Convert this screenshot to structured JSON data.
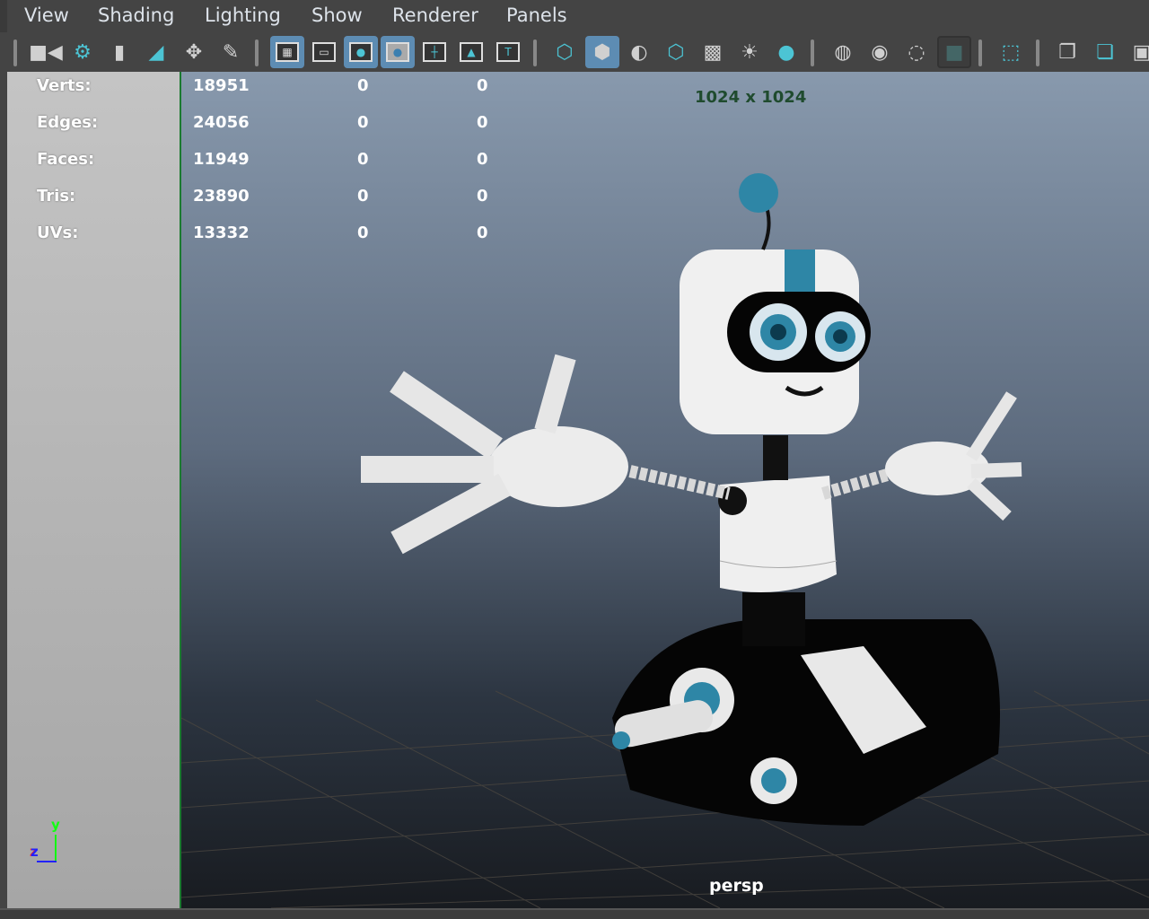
{
  "menu": [
    "View",
    "Shading",
    "Lighting",
    "Show",
    "Renderer",
    "Panels"
  ],
  "toolbar_icons": [
    "camera-icon",
    "camera-attributes-icon",
    "bookmark-icon",
    "image-plane-icon",
    "2d-pan-zoom-icon",
    "grease-pencil-icon",
    "grid-icon",
    "film-gate-icon",
    "resolution-gate-icon",
    "gate-mask-icon",
    "field-chart-icon",
    "safe-action-icon",
    "safe-title-icon",
    "wireframe-icon",
    "smooth-shade-icon",
    "default-material-icon",
    "wireframe-on-shaded-icon",
    "textured-icon",
    "lights-icon",
    "shadows-icon",
    "screen-space-ao-icon",
    "motion-blur-icon",
    "anti-aliasing-icon",
    "depth-of-field-icon",
    "isolate-select-icon",
    "xray-icon",
    "xray-joints-icon",
    "xray-active-icon"
  ],
  "stats": [
    {
      "label": "Verts:",
      "values": [
        "18951",
        "0",
        "0"
      ]
    },
    {
      "label": "Edges:",
      "values": [
        "24056",
        "0",
        "0"
      ]
    },
    {
      "label": "Faces:",
      "values": [
        "11949",
        "0",
        "0"
      ]
    },
    {
      "label": "Tris:",
      "values": [
        "23890",
        "0",
        "0"
      ]
    },
    {
      "label": "UVs:",
      "values": [
        "13332",
        "0",
        "0"
      ]
    }
  ],
  "resolution": "1024 x 1024",
  "camera": "persp",
  "axis": {
    "y": "y",
    "z": "z"
  },
  "colors": {
    "accent": "#5d8cb3",
    "teal": "#2e86a6"
  }
}
